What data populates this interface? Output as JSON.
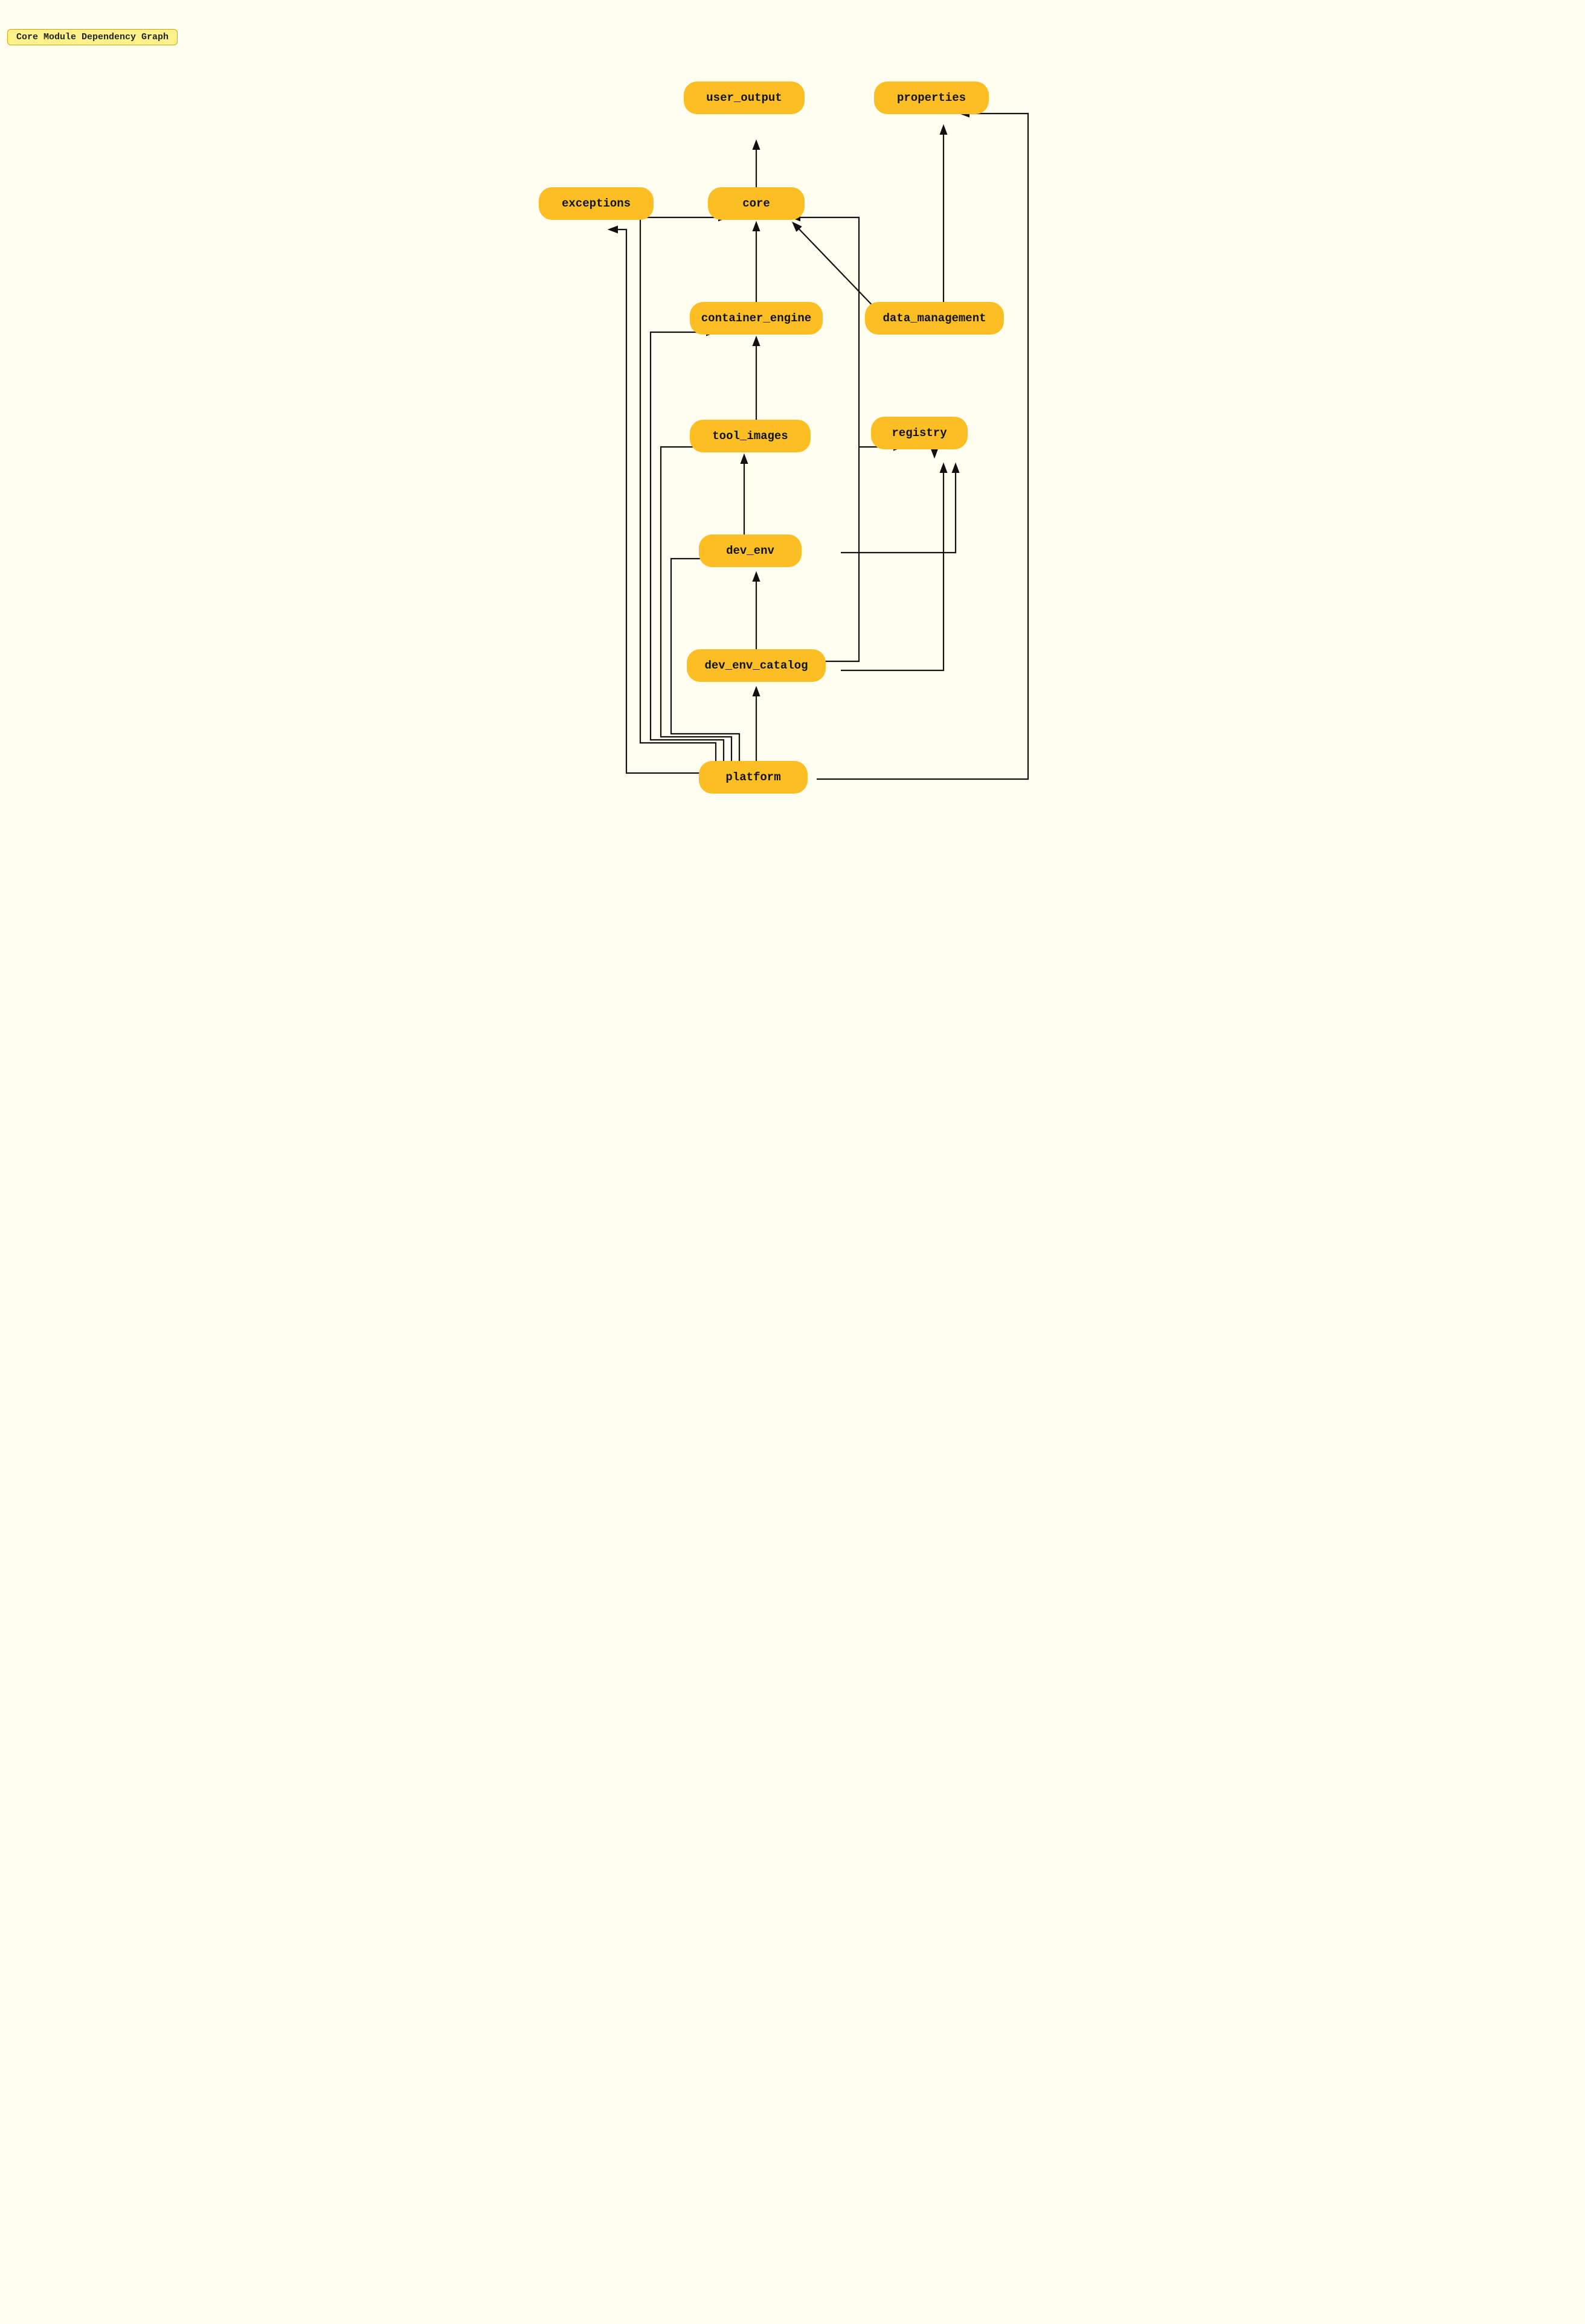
{
  "title": "Core Module Dependency Graph",
  "nodes": {
    "user_output": {
      "label": "user_output"
    },
    "properties": {
      "label": "properties"
    },
    "exceptions": {
      "label": "exceptions"
    },
    "core": {
      "label": "core"
    },
    "container_engine": {
      "label": "container_engine"
    },
    "data_management": {
      "label": "data_management"
    },
    "tool_images": {
      "label": "tool_images"
    },
    "registry": {
      "label": "registry"
    },
    "dev_env": {
      "label": "dev_env"
    },
    "dev_env_catalog": {
      "label": "dev_env_catalog"
    },
    "platform": {
      "label": "platform"
    }
  },
  "colors": {
    "node_bg": "#fbbf24",
    "node_border": "#d97706",
    "arrow": "#111111",
    "bg": "#fffef0",
    "title_bg": "#fef08a",
    "title_border": "#d4a800"
  }
}
